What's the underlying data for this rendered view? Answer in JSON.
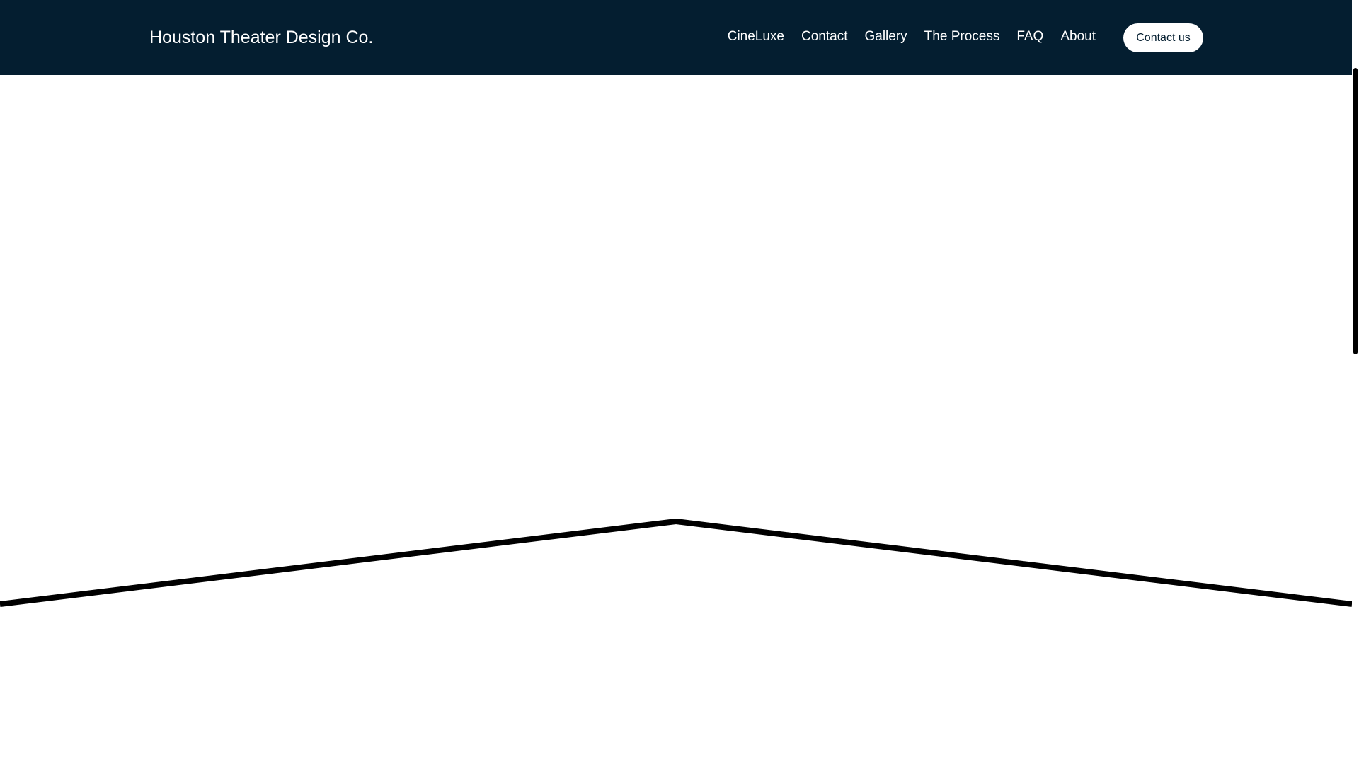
{
  "header": {
    "brand": "Houston Theater Design Co.",
    "nav": [
      "CineLuxe",
      "Contact",
      "Gallery",
      "The Process",
      "FAQ",
      "About"
    ],
    "cta_label": "Contact us"
  },
  "colors": {
    "header_background": "#041e30",
    "header_text": "#ffffff",
    "page_background": "#ffffff",
    "divider_line": "#000000"
  }
}
